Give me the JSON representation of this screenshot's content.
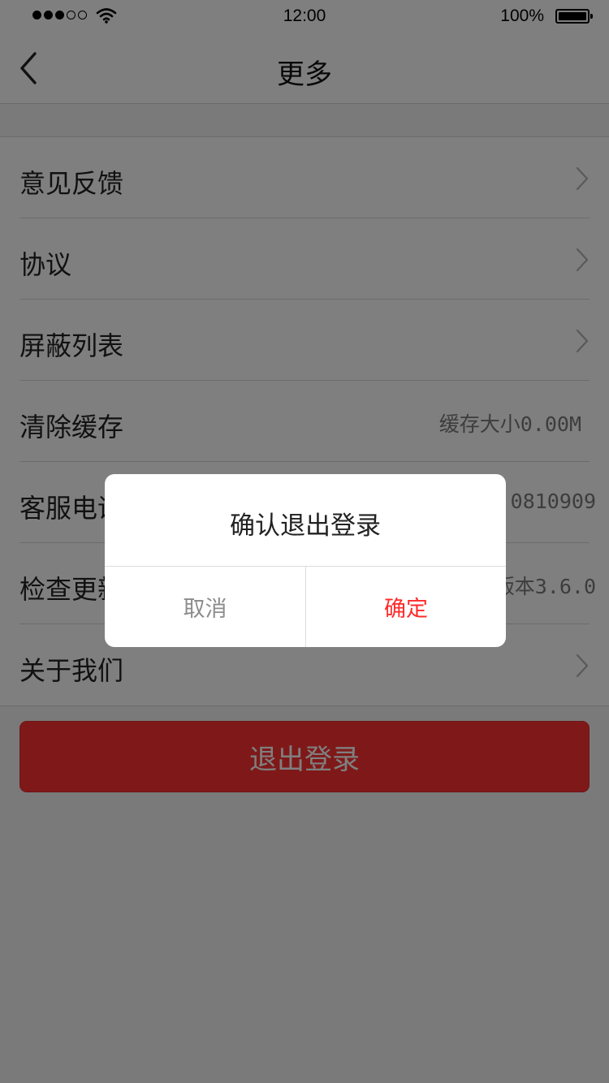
{
  "status_bar": {
    "time": "12:00",
    "battery_text": "100%",
    "signal_bars_filled": 3,
    "signal_bars_total": 5
  },
  "nav": {
    "title": "更多",
    "back_icon": "chevron-left-icon"
  },
  "menu": {
    "items": [
      {
        "label": "意见反馈",
        "value": "",
        "chevron": true
      },
      {
        "label": "协议",
        "value": "",
        "chevron": true
      },
      {
        "label": "屏蔽列表",
        "value": "",
        "chevron": true
      },
      {
        "label": "清除缓存",
        "value": "缓存大小0.00M",
        "chevron": false
      },
      {
        "label": "客服电话",
        "value": "0810909",
        "chevron": false
      },
      {
        "label": "检查更新",
        "value": "版本3.6.0",
        "chevron": false
      },
      {
        "label": "关于我们",
        "value": "",
        "chevron": true
      }
    ]
  },
  "logout": {
    "label": "退出登录"
  },
  "dialog": {
    "title": "确认退出登录",
    "cancel_label": "取消",
    "confirm_label": "确定"
  },
  "colors": {
    "accent": "#ff3333",
    "confirm_text": "#ff2a2a",
    "cancel_text": "#8c8c8c",
    "overlay": "rgba(0,0,0,0.5)"
  }
}
